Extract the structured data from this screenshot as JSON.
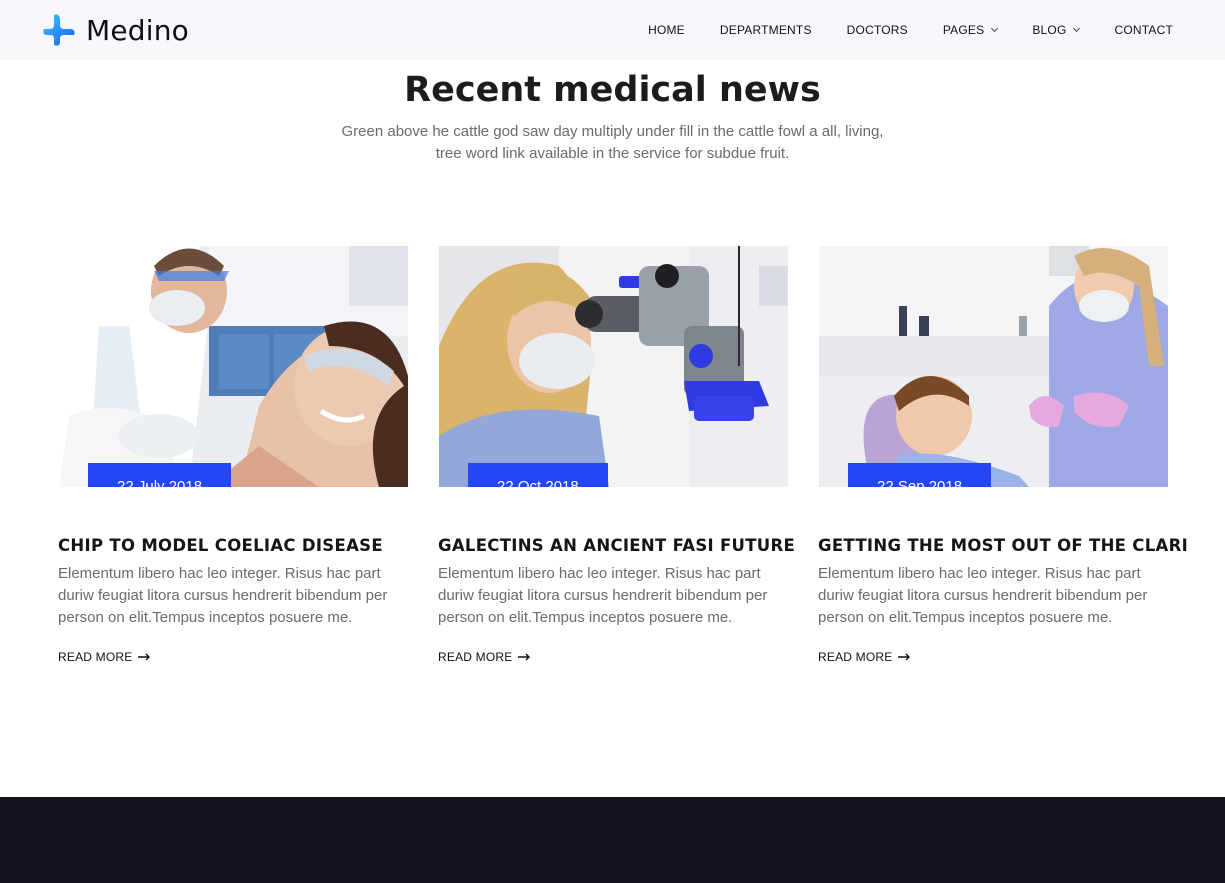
{
  "brand": {
    "name": "Medino",
    "accent": "#2546f5",
    "footer_color": "#12131f"
  },
  "nav": [
    {
      "label": "HOME",
      "dropdown": false
    },
    {
      "label": "DEPARTMENTS",
      "dropdown": false
    },
    {
      "label": "DOCTORS",
      "dropdown": false
    },
    {
      "label": "PAGES",
      "dropdown": true
    },
    {
      "label": "BLOG",
      "dropdown": true
    },
    {
      "label": "CONTACT",
      "dropdown": false
    }
  ],
  "section": {
    "title": "Recent medical news",
    "subtitle": "Green above he cattle god saw day multiply under fill in the cattle fowl a all, living, tree word link available in the service for subdue fruit."
  },
  "posts": [
    {
      "date": "22 July 2018",
      "title": "CHIP TO MODEL COELIAC DISEASE",
      "excerpt": "Elementum libero hac leo integer. Risus hac part duriw feugiat litora cursus hendrerit bibendum per person on elit.Tempus inceptos posuere me.",
      "read_more": "READ MORE",
      "image": "dentist-examining-woman-photo"
    },
    {
      "date": "22 Oct 2018",
      "title": "GALECTINS AN ANCIENT FASI FUTURE",
      "excerpt": "Elementum libero hac leo integer. Risus hac part duriw feugiat litora cursus hendrerit bibendum per person on elit.Tempus inceptos posuere me.",
      "read_more": "READ MORE",
      "image": "doctor-with-microscope-photo"
    },
    {
      "date": "22 Sep 2018",
      "title": "GETTING THE MOST OUT OF THE CLARI",
      "excerpt": "Elementum libero hac leo integer. Risus hac part duriw feugiat litora cursus hendrerit bibendum per person on elit.Tempus inceptos posuere me.",
      "read_more": "READ MORE",
      "image": "dentist-with-child-photo"
    }
  ]
}
